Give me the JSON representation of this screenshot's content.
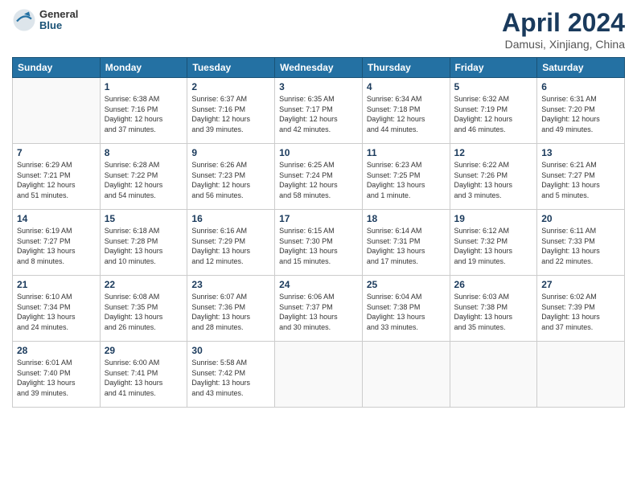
{
  "header": {
    "logo": {
      "general": "General",
      "blue": "Blue"
    },
    "title": "April 2024",
    "location": "Damusi, Xinjiang, China"
  },
  "days_of_week": [
    "Sunday",
    "Monday",
    "Tuesday",
    "Wednesday",
    "Thursday",
    "Friday",
    "Saturday"
  ],
  "weeks": [
    [
      {
        "day": "",
        "info": ""
      },
      {
        "day": "1",
        "info": "Sunrise: 6:38 AM\nSunset: 7:16 PM\nDaylight: 12 hours\nand 37 minutes."
      },
      {
        "day": "2",
        "info": "Sunrise: 6:37 AM\nSunset: 7:16 PM\nDaylight: 12 hours\nand 39 minutes."
      },
      {
        "day": "3",
        "info": "Sunrise: 6:35 AM\nSunset: 7:17 PM\nDaylight: 12 hours\nand 42 minutes."
      },
      {
        "day": "4",
        "info": "Sunrise: 6:34 AM\nSunset: 7:18 PM\nDaylight: 12 hours\nand 44 minutes."
      },
      {
        "day": "5",
        "info": "Sunrise: 6:32 AM\nSunset: 7:19 PM\nDaylight: 12 hours\nand 46 minutes."
      },
      {
        "day": "6",
        "info": "Sunrise: 6:31 AM\nSunset: 7:20 PM\nDaylight: 12 hours\nand 49 minutes."
      }
    ],
    [
      {
        "day": "7",
        "info": "Sunrise: 6:29 AM\nSunset: 7:21 PM\nDaylight: 12 hours\nand 51 minutes."
      },
      {
        "day": "8",
        "info": "Sunrise: 6:28 AM\nSunset: 7:22 PM\nDaylight: 12 hours\nand 54 minutes."
      },
      {
        "day": "9",
        "info": "Sunrise: 6:26 AM\nSunset: 7:23 PM\nDaylight: 12 hours\nand 56 minutes."
      },
      {
        "day": "10",
        "info": "Sunrise: 6:25 AM\nSunset: 7:24 PM\nDaylight: 12 hours\nand 58 minutes."
      },
      {
        "day": "11",
        "info": "Sunrise: 6:23 AM\nSunset: 7:25 PM\nDaylight: 13 hours\nand 1 minute."
      },
      {
        "day": "12",
        "info": "Sunrise: 6:22 AM\nSunset: 7:26 PM\nDaylight: 13 hours\nand 3 minutes."
      },
      {
        "day": "13",
        "info": "Sunrise: 6:21 AM\nSunset: 7:27 PM\nDaylight: 13 hours\nand 5 minutes."
      }
    ],
    [
      {
        "day": "14",
        "info": "Sunrise: 6:19 AM\nSunset: 7:27 PM\nDaylight: 13 hours\nand 8 minutes."
      },
      {
        "day": "15",
        "info": "Sunrise: 6:18 AM\nSunset: 7:28 PM\nDaylight: 13 hours\nand 10 minutes."
      },
      {
        "day": "16",
        "info": "Sunrise: 6:16 AM\nSunset: 7:29 PM\nDaylight: 13 hours\nand 12 minutes."
      },
      {
        "day": "17",
        "info": "Sunrise: 6:15 AM\nSunset: 7:30 PM\nDaylight: 13 hours\nand 15 minutes."
      },
      {
        "day": "18",
        "info": "Sunrise: 6:14 AM\nSunset: 7:31 PM\nDaylight: 13 hours\nand 17 minutes."
      },
      {
        "day": "19",
        "info": "Sunrise: 6:12 AM\nSunset: 7:32 PM\nDaylight: 13 hours\nand 19 minutes."
      },
      {
        "day": "20",
        "info": "Sunrise: 6:11 AM\nSunset: 7:33 PM\nDaylight: 13 hours\nand 22 minutes."
      }
    ],
    [
      {
        "day": "21",
        "info": "Sunrise: 6:10 AM\nSunset: 7:34 PM\nDaylight: 13 hours\nand 24 minutes."
      },
      {
        "day": "22",
        "info": "Sunrise: 6:08 AM\nSunset: 7:35 PM\nDaylight: 13 hours\nand 26 minutes."
      },
      {
        "day": "23",
        "info": "Sunrise: 6:07 AM\nSunset: 7:36 PM\nDaylight: 13 hours\nand 28 minutes."
      },
      {
        "day": "24",
        "info": "Sunrise: 6:06 AM\nSunset: 7:37 PM\nDaylight: 13 hours\nand 30 minutes."
      },
      {
        "day": "25",
        "info": "Sunrise: 6:04 AM\nSunset: 7:38 PM\nDaylight: 13 hours\nand 33 minutes."
      },
      {
        "day": "26",
        "info": "Sunrise: 6:03 AM\nSunset: 7:38 PM\nDaylight: 13 hours\nand 35 minutes."
      },
      {
        "day": "27",
        "info": "Sunrise: 6:02 AM\nSunset: 7:39 PM\nDaylight: 13 hours\nand 37 minutes."
      }
    ],
    [
      {
        "day": "28",
        "info": "Sunrise: 6:01 AM\nSunset: 7:40 PM\nDaylight: 13 hours\nand 39 minutes."
      },
      {
        "day": "29",
        "info": "Sunrise: 6:00 AM\nSunset: 7:41 PM\nDaylight: 13 hours\nand 41 minutes."
      },
      {
        "day": "30",
        "info": "Sunrise: 5:58 AM\nSunset: 7:42 PM\nDaylight: 13 hours\nand 43 minutes."
      },
      {
        "day": "",
        "info": ""
      },
      {
        "day": "",
        "info": ""
      },
      {
        "day": "",
        "info": ""
      },
      {
        "day": "",
        "info": ""
      }
    ]
  ]
}
